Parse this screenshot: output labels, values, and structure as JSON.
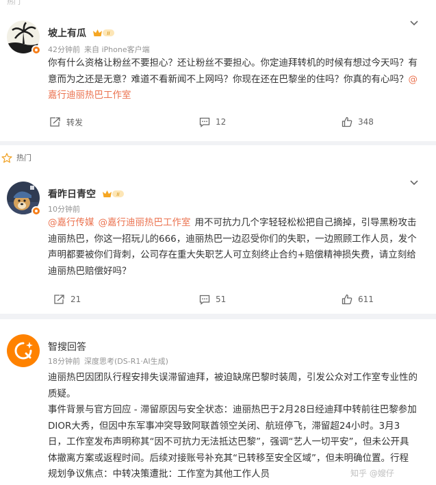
{
  "top_strip": {
    "text": "热门"
  },
  "post1": {
    "author": "坡上有瓜",
    "time": "42分钟前",
    "source": "来自 iPhone客户端",
    "text": "你有什么资格让粉丝不要担心？还让粉丝不要担心。你定迪拜转机的时候有想过今天吗？有意而为之还是无意？难道不看新闻不上网吗？你现在还在巴黎坐的住吗？你真的有心吗？",
    "mention": "@嘉行迪丽热巴工作室",
    "repost_label": "转发",
    "comments": "12",
    "likes": "348"
  },
  "post2": {
    "hot_label": "热门",
    "author": "看昨日青空",
    "time": "10分钟前",
    "mention1": "@嘉行传媒",
    "mention2": "@嘉行迪丽热巴工作室",
    "text": "用不可抗力几个字轻轻松松把自己摘掉，引导黑粉攻击迪丽热巴，你这一招玩儿的666，迪丽热巴一边忍受你们的失职，一边照顾工作人员，发个声明都要被你们背刺，公司存在重大失职艺人可立刻终止合约+赔偿精神损失费，请立刻给迪丽热巴赔偿好吗？",
    "reposts": "21",
    "comments": "51",
    "likes": "611"
  },
  "ai": {
    "title": "智搜回答",
    "time": "18分钟前",
    "mode": "深度思考(DS-R1·AI生成)",
    "summary": "迪丽热巴因团队行程安排失误滞留迪拜，被迫缺席巴黎时装周，引发公众对工作室专业性的质疑。",
    "detail": "事件背景与官方回应 - 滞留原因与安全状态：迪丽热巴于2月28日经迪拜中转前往巴黎参加DIOR大秀，但因中东军事冲突导致阿联酋领空关闭、航班停飞，滞留超24小时。3月3日，工作室发布声明称其“因不可抗力无法抵达巴黎”，强调“艺人一切平安”，但未公开具体撤离方案或返程时间。后续对接账号补充其“已转移至安全区域”，但未明确位置。行程规划争议焦点：中转决策遭批：工作室为其他工作人员"
  },
  "watermark": "知乎 @嫂仔",
  "colors": {
    "mention": "#eb7350",
    "accent": "#ff8200",
    "badge": "#f57d18"
  }
}
